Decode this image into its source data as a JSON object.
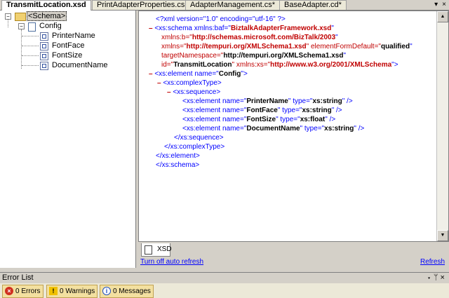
{
  "tabs": [
    {
      "label": "TransmitLocation.xsd",
      "active": true
    },
    {
      "label": "PrintAdapterProperties.cs",
      "active": false
    },
    {
      "label": "AdapterManagement.cs*",
      "active": false
    },
    {
      "label": "BaseAdapter.cd*",
      "active": false
    }
  ],
  "tab_controls": {
    "dropdown": "▾",
    "close": "×"
  },
  "tree": {
    "root_label": "<Schema>",
    "config_label": "Config",
    "children": [
      "PrinterName",
      "FontFace",
      "FontSize",
      "DocumentName"
    ]
  },
  "xml": {
    "line1_a": "<?xml version=\"1.0\" encoding=\"utf-16\" ?>",
    "line2_tag": "<xs:schema xmlns:baf=\"",
    "line2_val": "BiztalkAdapterFramework.xsd",
    "line3_attr": "xmlns:b=\"",
    "line3_val": "http://schemas.microsoft.com/BizTalk/2003",
    "line4_attr": "xmlns=\"",
    "line4_val": "http://tempuri.org/XMLSchema1.xsd",
    "line4_attr2": "\" elementFormDefault=\"",
    "line4_val2": "qualified",
    "line5_attr": "targetNamespace=\"",
    "line5_val": "http://tempuri.org/XMLSchema1.xsd",
    "line6_attr": "id=\"",
    "line6_val": "TransmitLocation",
    "line6_attr2": "\" xmlns:xs=\"",
    "line6_val2": "http://www.w3.org/2001/XMLSchema",
    "line6_end": "\">",
    "line7_tag": "<xs:element name=\"",
    "line7_val": "Config",
    "line7_end": "\">",
    "line8": "<xs:complexType>",
    "line9": "<xs:sequence>",
    "el_open": "<xs:element name=\"",
    "el_type": "\" type=\"",
    "el_close": "\" />",
    "elements": [
      {
        "name": "PrinterName",
        "type": "xs:string"
      },
      {
        "name": "FontFace",
        "type": "xs:string"
      },
      {
        "name": "FontSize",
        "type": "xs:float"
      },
      {
        "name": "DocumentName",
        "type": "xs:string"
      }
    ],
    "close_seq": "</xs:sequence>",
    "close_ct": "</xs:complexType>",
    "close_el": "</xs:element>",
    "close_schema": "</xs:schema>",
    "collapse": "–"
  },
  "bottom_tab": "XSD",
  "links": {
    "auto_refresh": "Turn off auto refresh",
    "refresh": "Refresh"
  },
  "error_list": {
    "title": "Error List",
    "controls": "▾  ᛘ  ×",
    "errors": "0 Errors",
    "warnings": "0 Warnings",
    "messages": "0 Messages"
  }
}
